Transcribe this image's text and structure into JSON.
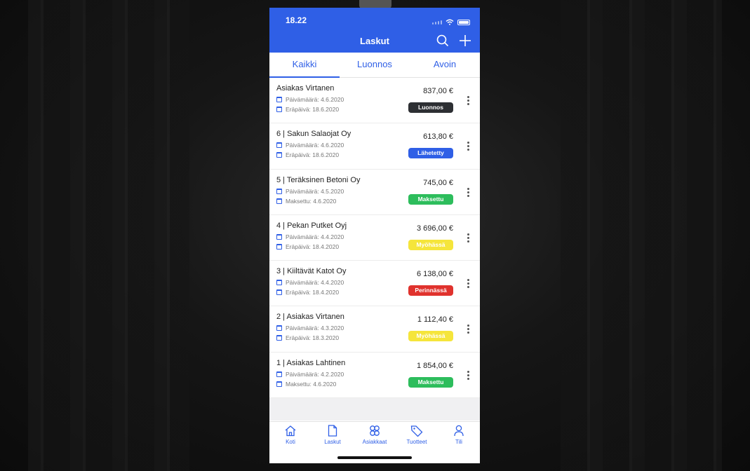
{
  "status": {
    "time": "18.22"
  },
  "header": {
    "title": "Laskut"
  },
  "tabs": [
    {
      "label": "Kaikki",
      "active": true
    },
    {
      "label": "Luonnos",
      "active": false
    },
    {
      "label": "Avoin",
      "active": false
    }
  ],
  "invoices": [
    {
      "name": "Asiakas Virtanen",
      "date": "Päivämäärä: 4.6.2020",
      "second": "Eräpäivä: 18.6.2020",
      "amount": "837,00 €",
      "status": "Luonnos",
      "status_color": "#2d2f33",
      "status_text_color": "#ffffff"
    },
    {
      "name": "6 | Sakun Salaojat Oy",
      "date": "Päivämäärä: 4.6.2020",
      "second": "Eräpäivä: 18.6.2020",
      "amount": "613,80 €",
      "status": "Lähetetty",
      "status_color": "#2f5fe6",
      "status_text_color": "#ffffff"
    },
    {
      "name": "5 | Teräksinen Betoni Oy",
      "date": "Päivämäärä: 4.5.2020",
      "second": "Maksettu: 4.6.2020",
      "amount": "745,00 €",
      "status": "Maksettu",
      "status_color": "#2dbd5c",
      "status_text_color": "#ffffff"
    },
    {
      "name": "4 | Pekan Putket Oyj",
      "date": "Päivämäärä: 4.4.2020",
      "second": "Eräpäivä: 18.4.2020",
      "amount": "3 696,00 €",
      "status": "Myöhässä",
      "status_color": "#f5e53b",
      "status_text_color": "#ffffff"
    },
    {
      "name": "3 | Kiiltävät Katot Oy",
      "date": "Päivämäärä: 4.4.2020",
      "second": "Eräpäivä: 18.4.2020",
      "amount": "6 138,00 €",
      "status": "Perinnässä",
      "status_color": "#e0322d",
      "status_text_color": "#ffffff"
    },
    {
      "name": "2 | Asiakas Virtanen",
      "date": "Päivämäärä: 4.3.2020",
      "second": "Eräpäivä: 18.3.2020",
      "amount": "1 112,40 €",
      "status": "Myöhässä",
      "status_color": "#f5e53b",
      "status_text_color": "#ffffff"
    },
    {
      "name": "1 | Asiakas Lahtinen",
      "date": "Päivämäärä: 4.2.2020",
      "second": "Maksettu: 4.6.2020",
      "amount": "1 854,00 €",
      "status": "Maksettu",
      "status_color": "#2dbd5c",
      "status_text_color": "#ffffff"
    }
  ],
  "bottom_nav": [
    {
      "label": "Koti",
      "icon": "home-icon"
    },
    {
      "label": "Laskut",
      "icon": "document-icon"
    },
    {
      "label": "Asiakkaat",
      "icon": "customers-icon"
    },
    {
      "label": "Tuotteet",
      "icon": "tag-icon"
    },
    {
      "label": "Tili",
      "icon": "user-icon"
    }
  ],
  "colors": {
    "accent": "#2f5fe6"
  }
}
